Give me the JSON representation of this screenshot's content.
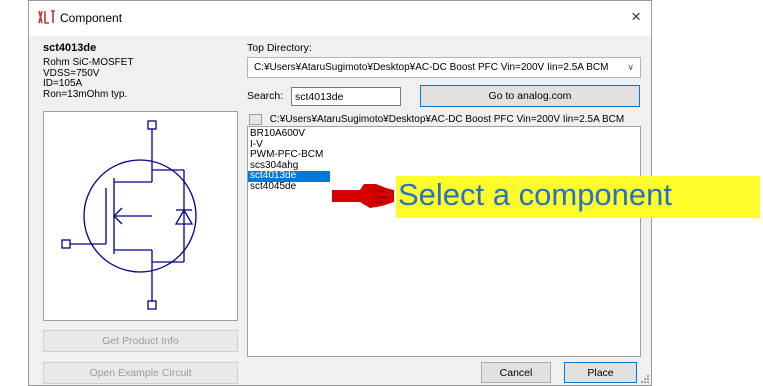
{
  "window": {
    "title": "Component",
    "close_glyph": "×"
  },
  "component": {
    "name": "sct4013de",
    "description_lines": [
      "Rohm SiC-MOSFET",
      "VDSS=750V",
      "ID=105A",
      "Ron=13mOhm typ."
    ]
  },
  "buttons": {
    "get_product_info": "Get Product Info",
    "open_example": "Open Example Circuit",
    "go_to_analog": "Go to analog.com",
    "cancel": "Cancel",
    "place": "Place"
  },
  "top_directory": {
    "label": "Top Directory:",
    "value": "C:¥Users¥AtaruSugimoto¥Desktop¥AC-DC Boost PFC Vin=200V Iin=2.5A BCM"
  },
  "search": {
    "label": "Search:",
    "value": "sct4013de"
  },
  "current_path": "C:¥Users¥AtaruSugimoto¥Desktop¥AC-DC Boost PFC Vin=200V Iin=2.5A BCM",
  "files": {
    "items": [
      "BR10A600V",
      "I-V",
      "PWM-PFC-BCM",
      "scs304ahg",
      "sct4013de",
      "sct4045de"
    ],
    "selected": "sct4013de"
  },
  "annotation": {
    "text": "Select a component",
    "highlight_color": "#fdfd2c",
    "text_color": "#2c70c4"
  },
  "colors": {
    "schematic": "#00008b",
    "selection": "#0078d7",
    "pointer_hand": "#d40000"
  },
  "icons": [
    "ltspice-logo-icon",
    "close-icon",
    "folder-icon",
    "chevron-down-icon",
    "pointing-hand-icon",
    "resize-grip-icon"
  ]
}
